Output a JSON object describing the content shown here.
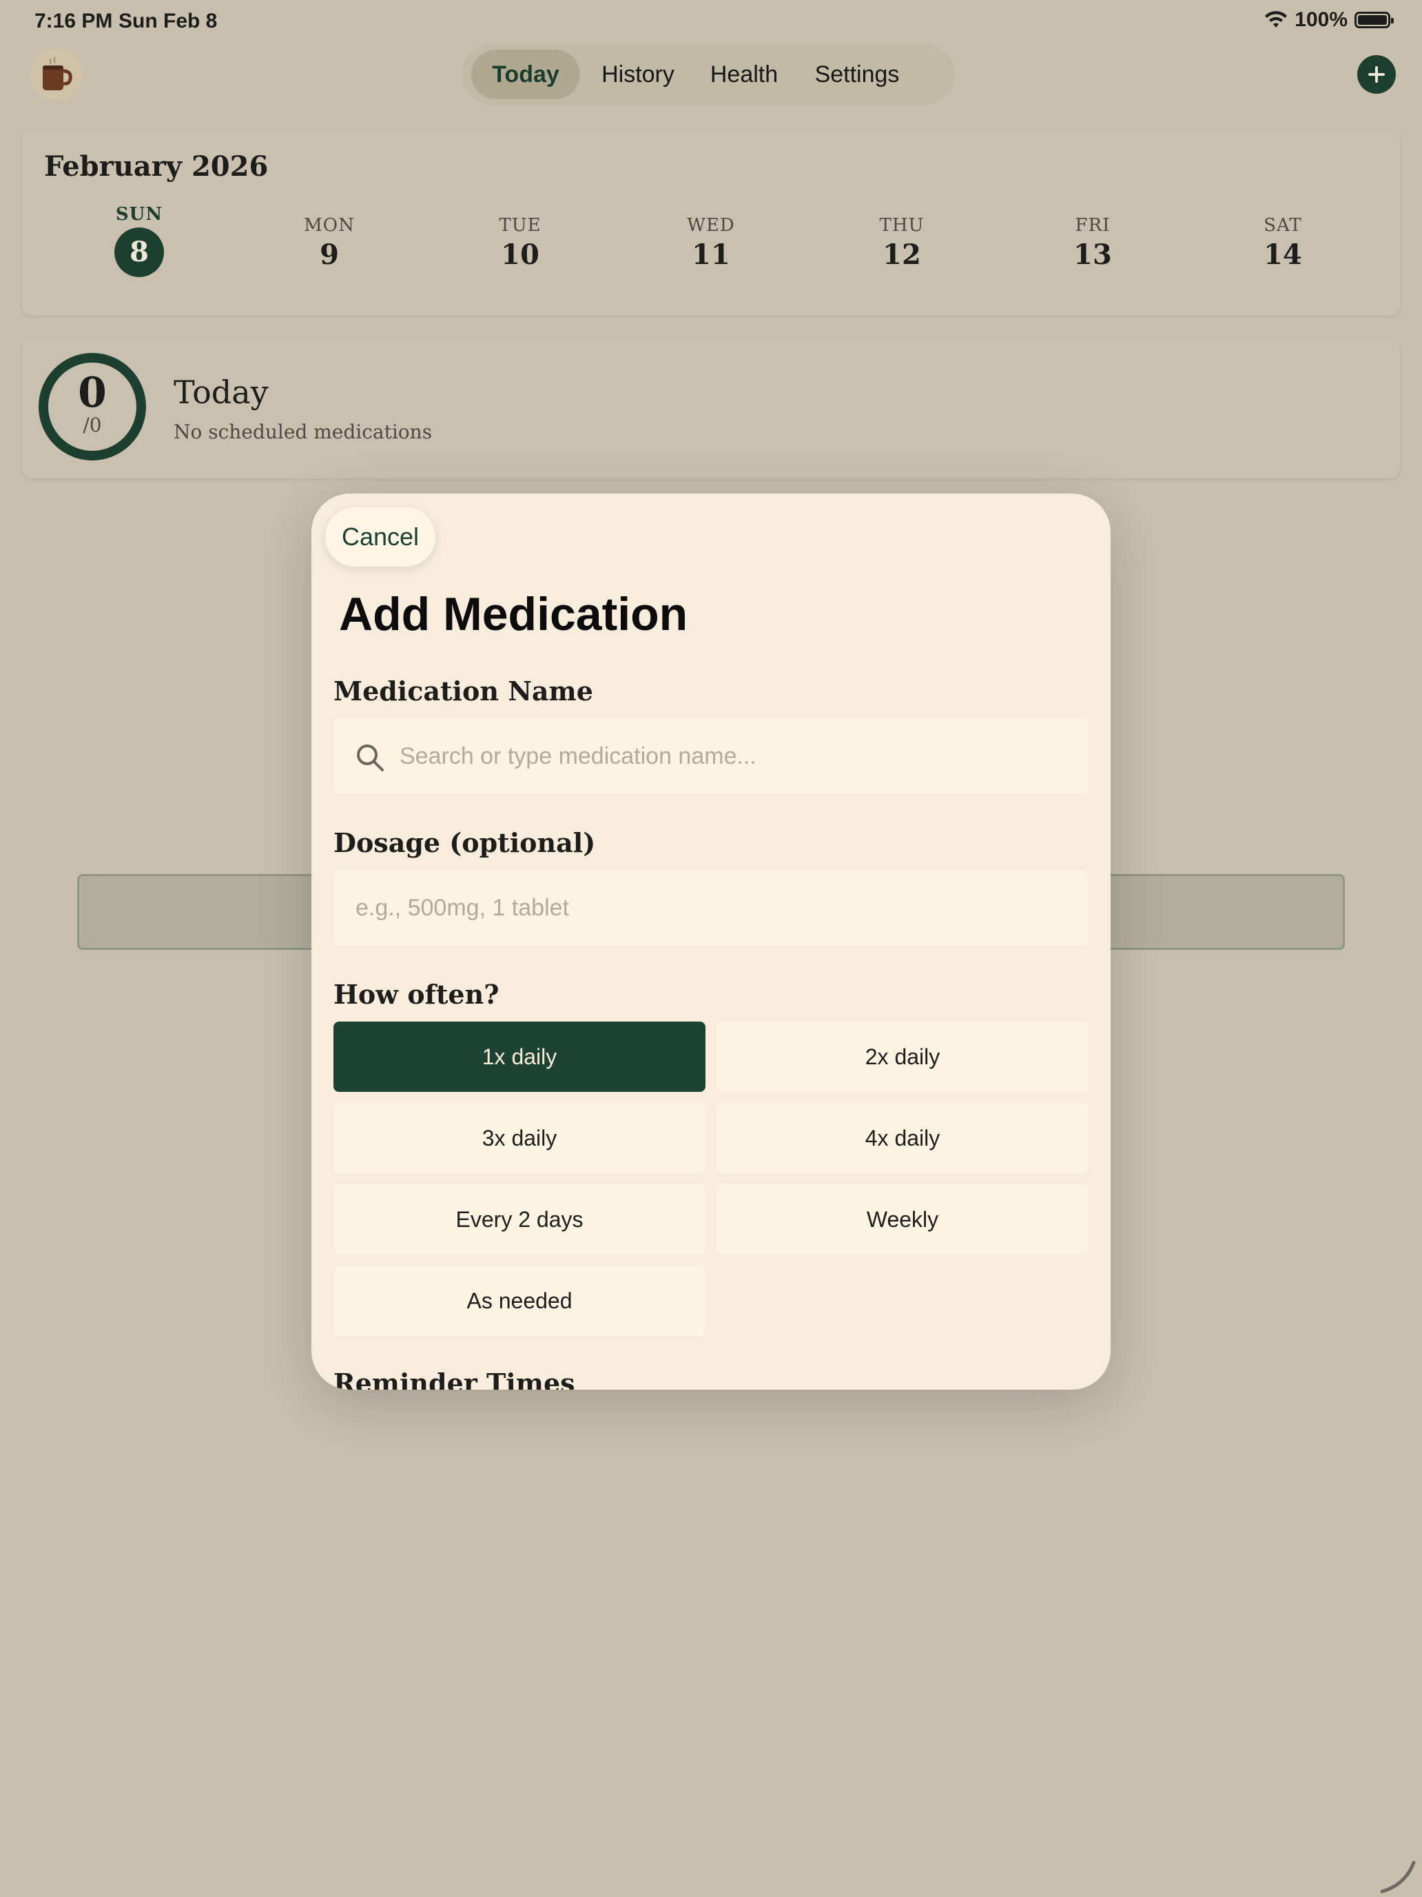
{
  "status_bar": {
    "time": "7:16 PM",
    "date": "Sun Feb 8",
    "battery": "100%"
  },
  "nav": {
    "tabs": [
      {
        "label": "Today",
        "active": true
      },
      {
        "label": "History",
        "active": false
      },
      {
        "label": "Health",
        "active": false
      },
      {
        "label": "Settings",
        "active": false
      }
    ]
  },
  "calendar": {
    "month_title": "February 2026",
    "days": [
      {
        "name": "SUN",
        "num": "8",
        "selected": true
      },
      {
        "name": "MON",
        "num": "9"
      },
      {
        "name": "TUE",
        "num": "10"
      },
      {
        "name": "WED",
        "num": "11"
      },
      {
        "name": "THU",
        "num": "12"
      },
      {
        "name": "FRI",
        "num": "13"
      },
      {
        "name": "SAT",
        "num": "14"
      }
    ]
  },
  "today": {
    "taken": "0",
    "total": "/0",
    "title": "Today",
    "subtitle": "No scheduled medications"
  },
  "modal": {
    "cancel_label": "Cancel",
    "title": "Add Medication",
    "name_label": "Medication Name",
    "name_placeholder": "Search or type medication name...",
    "dosage_label": "Dosage (optional)",
    "dosage_placeholder": "e.g., 500mg, 1 tablet",
    "frequency_label": "How often?",
    "frequency_options": [
      {
        "label": "1x daily",
        "selected": true
      },
      {
        "label": "2x daily"
      },
      {
        "label": "3x daily"
      },
      {
        "label": "4x daily"
      },
      {
        "label": "Every 2 days"
      },
      {
        "label": "Weekly"
      },
      {
        "label": "As needed"
      }
    ],
    "reminder_label": "Reminder Times"
  },
  "colors": {
    "accent": "#1d3f30",
    "background": "#c8bfae",
    "sheet": "#f8ecdc"
  }
}
